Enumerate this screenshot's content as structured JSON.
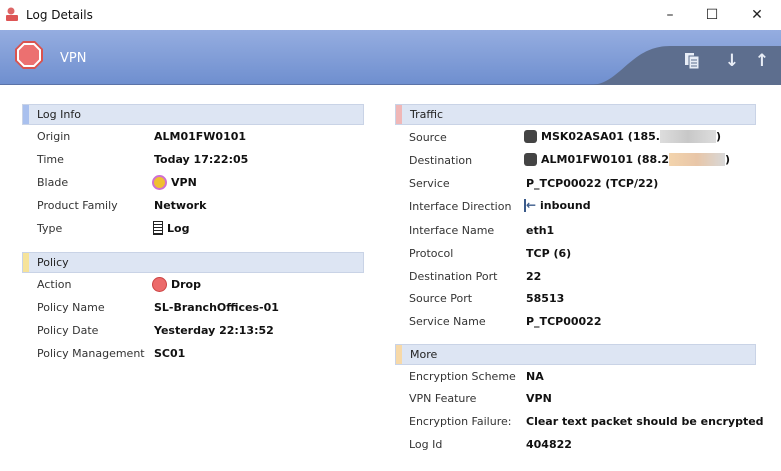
{
  "window": {
    "title": "Log Details",
    "minimize": "–",
    "maximize": "☐",
    "close": "✕"
  },
  "banner": {
    "title": "VPN",
    "buttons": {
      "copy": "copy-icon",
      "down": "↓",
      "up": "↑"
    }
  },
  "colors": {
    "log_info": "#a9c0ee",
    "policy": "#f6e39a",
    "traffic": "#f0b7b7",
    "more": "#f7d9a8"
  },
  "log_info": {
    "title": "Log Info",
    "rows": [
      {
        "label": "Origin",
        "value": "ALM01FW0101"
      },
      {
        "label": "Time",
        "value": "Today 17:22:05"
      },
      {
        "label": "Blade",
        "value": "VPN"
      },
      {
        "label": "Product Family",
        "value": "Network"
      },
      {
        "label": "Type",
        "value": "Log"
      }
    ]
  },
  "policy": {
    "title": "Policy",
    "rows": [
      {
        "label": "Action",
        "value": "Drop"
      },
      {
        "label": "Policy Name",
        "value": "SL-BranchOffices-01"
      },
      {
        "label": "Policy Date",
        "value": "Yesterday 22:13:52"
      },
      {
        "label": "Policy Management",
        "value": "SC01"
      }
    ]
  },
  "traffic": {
    "title": "Traffic",
    "rows": [
      {
        "label": "Source",
        "value": "MSK02ASA01 (185.",
        "suffix": ")"
      },
      {
        "label": "Destination",
        "value": "ALM01FW0101 (88.2",
        "suffix": ")"
      },
      {
        "label": "Service",
        "value": "P_TCP00022 (TCP/22)"
      },
      {
        "label": "Interface Direction",
        "value": "inbound"
      },
      {
        "label": "Interface Name",
        "value": "eth1"
      },
      {
        "label": "Protocol",
        "value": "TCP (6)"
      },
      {
        "label": "Destination Port",
        "value": "22"
      },
      {
        "label": "Source Port",
        "value": "58513"
      },
      {
        "label": "Service Name",
        "value": "P_TCP00022"
      }
    ]
  },
  "more": {
    "title": "More",
    "rows": [
      {
        "label": "Encryption Scheme",
        "value": "NA"
      },
      {
        "label": "VPN Feature",
        "value": "VPN"
      },
      {
        "label": "Encryption Failure:",
        "value": "Clear text packet should be encrypted"
      },
      {
        "label": "Log Id",
        "value": "404822"
      }
    ]
  }
}
